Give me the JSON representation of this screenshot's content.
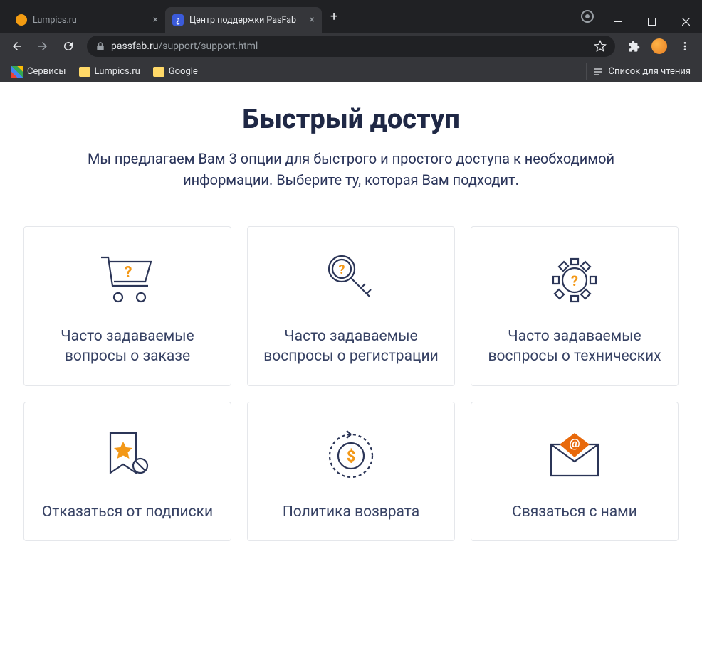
{
  "window": {
    "tabs": [
      {
        "title": "Lumpics.ru",
        "favicon_color": "#f39c12",
        "active": false
      },
      {
        "title": "Центр поддержки PasFab",
        "favicon_color": "#3b82f6",
        "active": true
      }
    ]
  },
  "address": {
    "domain": "passfab.ru",
    "path": "/support/support.html"
  },
  "bookmarks": {
    "apps_label": "Сервисы",
    "items": [
      {
        "label": "Lumpics.ru"
      },
      {
        "label": "Google"
      }
    ],
    "reading_list": "Список для чтения"
  },
  "page": {
    "heading": "Быстрый доступ",
    "subtitle": "Мы предлагаем Вам 3 опции для быстрого и простого доступа к необходимой информации. Выберите ту, которая Вам подходит.",
    "cards": [
      {
        "title": "Часто задаваемые вопросы о заказе"
      },
      {
        "title": "Часто задаваемые воспросы о регистрации"
      },
      {
        "title": "Часто задаваемые воспросы о технических"
      },
      {
        "title": "Отказаться от подписки"
      },
      {
        "title": "Политика возврата"
      },
      {
        "title": "Связаться с нами"
      }
    ]
  }
}
